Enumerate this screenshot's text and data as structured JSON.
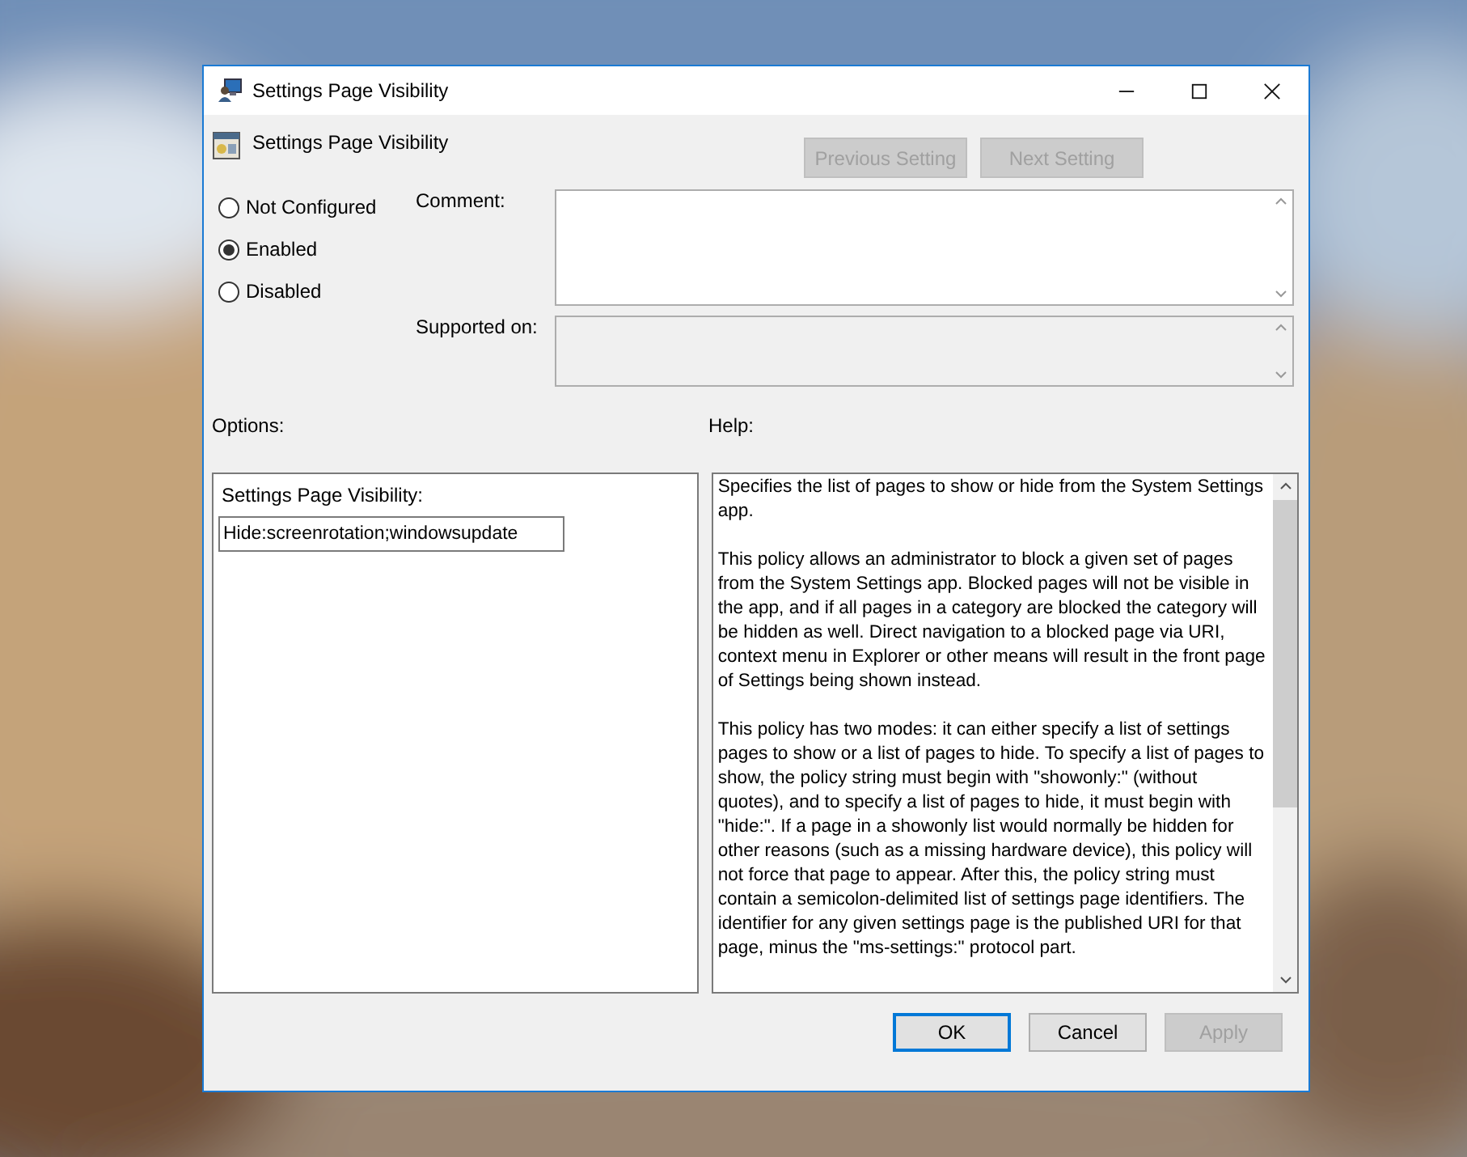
{
  "window": {
    "title": "Settings Page Visibility"
  },
  "header": {
    "title": "Settings Page Visibility"
  },
  "nav_buttons": [
    {
      "label": "Previous Setting",
      "disabled": true
    },
    {
      "label": "Next Setting",
      "disabled": true
    }
  ],
  "radios": [
    {
      "label": "Not Configured",
      "selected": false
    },
    {
      "label": "Enabled",
      "selected": true
    },
    {
      "label": "Disabled",
      "selected": false
    }
  ],
  "comment": {
    "label": "Comment:"
  },
  "supported_on": {
    "label": "Supported on:"
  },
  "options": {
    "label": "Options:",
    "field_label": "Settings Page Visibility:",
    "value": "Hide:screenrotation;windowsupdate"
  },
  "help": {
    "label": "Help:",
    "paragraphs": [
      "Specifies the list of pages to show or hide from the System Settings app.",
      "This policy allows an administrator to block a given set of pages from the System Settings app. Blocked pages will not be visible in the app, and if all pages in a category are blocked the category will be hidden as well. Direct navigation to a blocked page via URI, context menu in Explorer or other means will result in the front page of Settings being shown instead.",
      "This policy has two modes: it can either specify a list of settings pages to show or a list of pages to hide. To specify a list of pages to show, the policy string must begin with \"showonly:\" (without quotes), and to specify a list of pages to hide, it must begin with \"hide:\". If a page in a showonly list would normally be hidden for other reasons (such as a missing hardware device), this policy will not force that page to appear. After this, the policy string must contain a semicolon-delimited list of settings page identifiers. The identifier for any given settings page is the published URI for that page, minus the \"ms-settings:\" protocol part."
    ]
  },
  "buttons": [
    {
      "label": "OK",
      "kind": "default",
      "disabled": false
    },
    {
      "label": "Cancel",
      "kind": "normal",
      "disabled": false
    },
    {
      "label": "Apply",
      "kind": "normal",
      "disabled": true
    }
  ]
}
